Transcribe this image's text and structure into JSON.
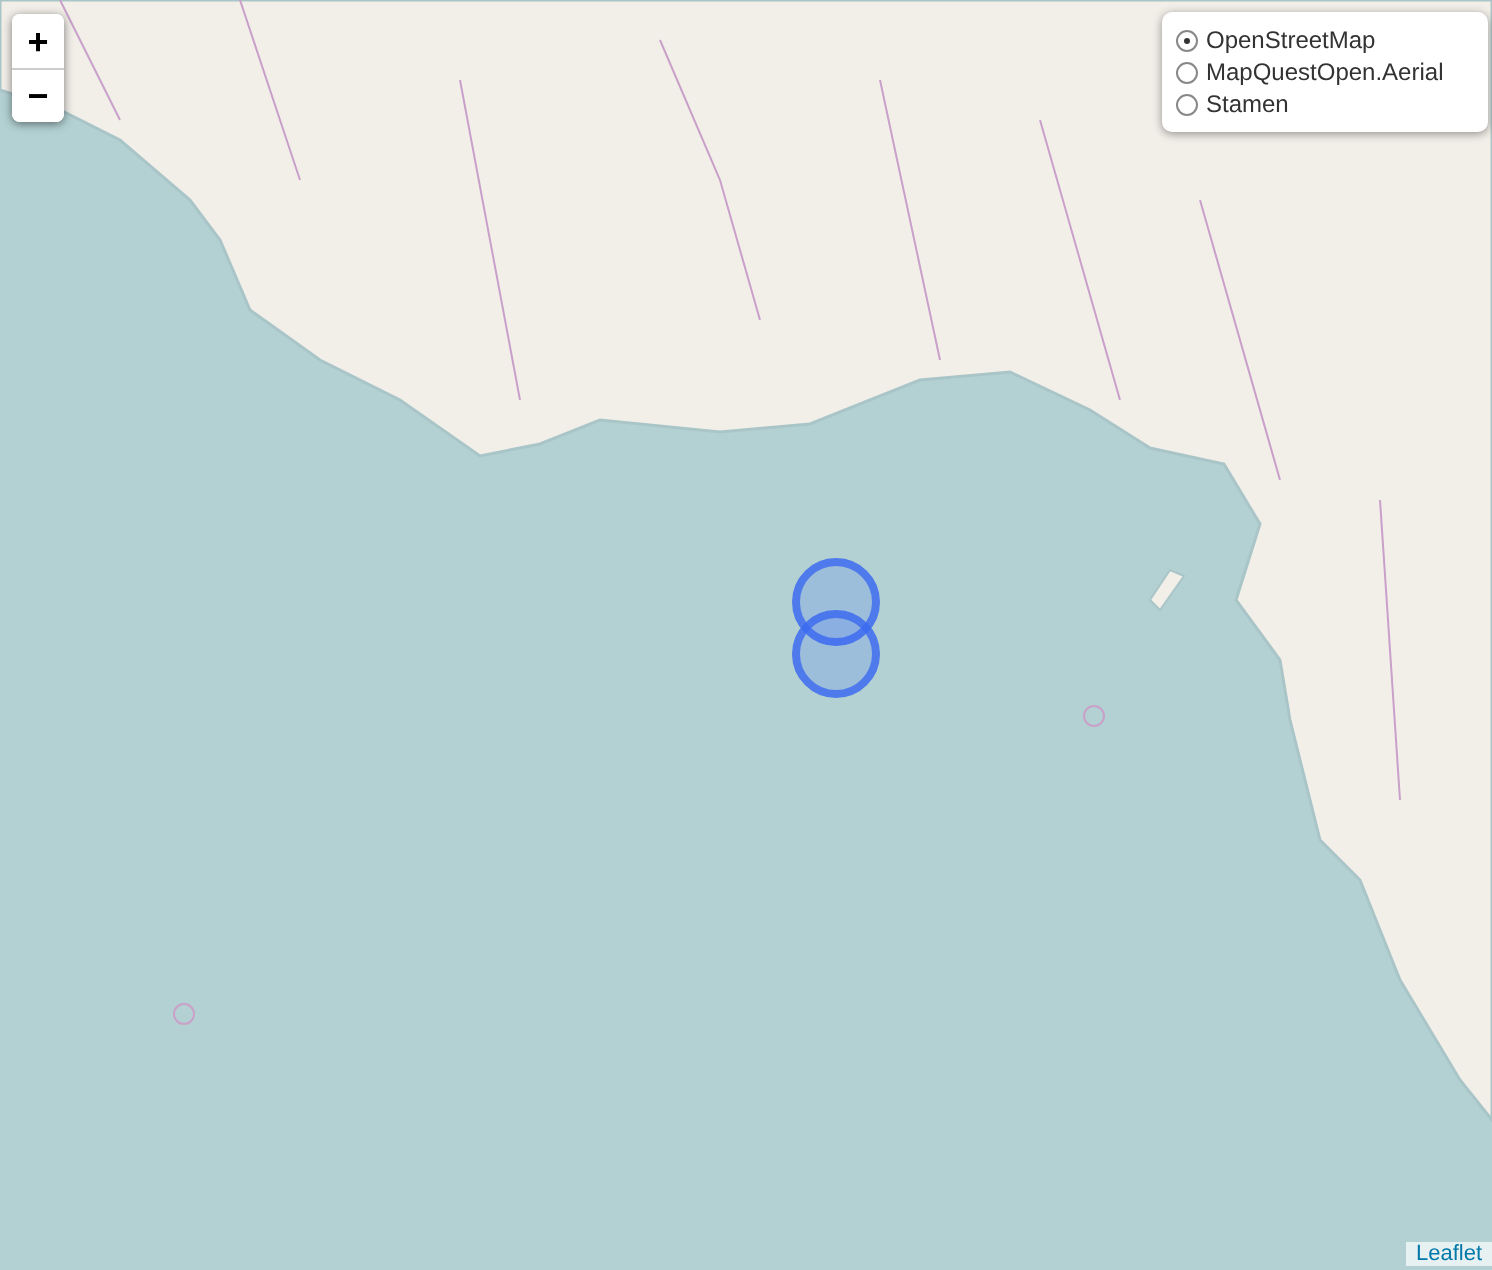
{
  "zoom_controls": [
    {
      "symbol": "+"
    },
    {
      "symbol": "−"
    }
  ],
  "layer_control": {
    "options": [
      {
        "label": "OpenStreetMap",
        "selected": true
      },
      {
        "label": "MapQuestOpen.Aerial",
        "selected": false
      },
      {
        "label": "Stamen",
        "selected": false
      }
    ]
  },
  "attribution": {
    "link": "Leaflet"
  }
}
